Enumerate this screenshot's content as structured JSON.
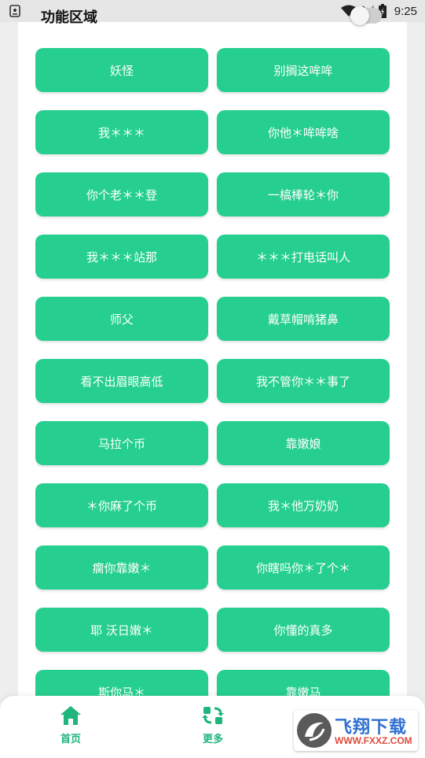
{
  "status_bar": {
    "time": "9:25"
  },
  "section": {
    "title": "功能区域"
  },
  "buttons": [
    "妖怪",
    "别搁这哞哞",
    "我＊＊＊",
    "你他＊哞哞啥",
    "你个老＊＊登",
    "一槁棒轮＊你",
    "我＊＊＊站那",
    "＊＊＊打电话叫人",
    "师父",
    "戴草帽啃猪鼻",
    "看不出眉眼高低",
    "我不管你＊＊事了",
    "马拉个币",
    "靠嫩娘",
    "＊你麻了个币",
    "我＊他万奶奶",
    "瘸你靠嫩＊",
    "你瞎吗你＊了个＊",
    "耶 沃日嫩＊",
    "你懂的真多",
    "斯你马＊",
    "靠嫩马"
  ],
  "bottom_nav": {
    "home": {
      "label": "首页",
      "icon": "home-icon"
    },
    "more": {
      "label": "更多",
      "icon": "refresh-icon"
    }
  },
  "watermark": {
    "title": "飞翔下载",
    "url": "WWW.FXXZ.COM"
  },
  "colors": {
    "accent": "#26cf8f",
    "nav_active": "#1fb57d"
  }
}
